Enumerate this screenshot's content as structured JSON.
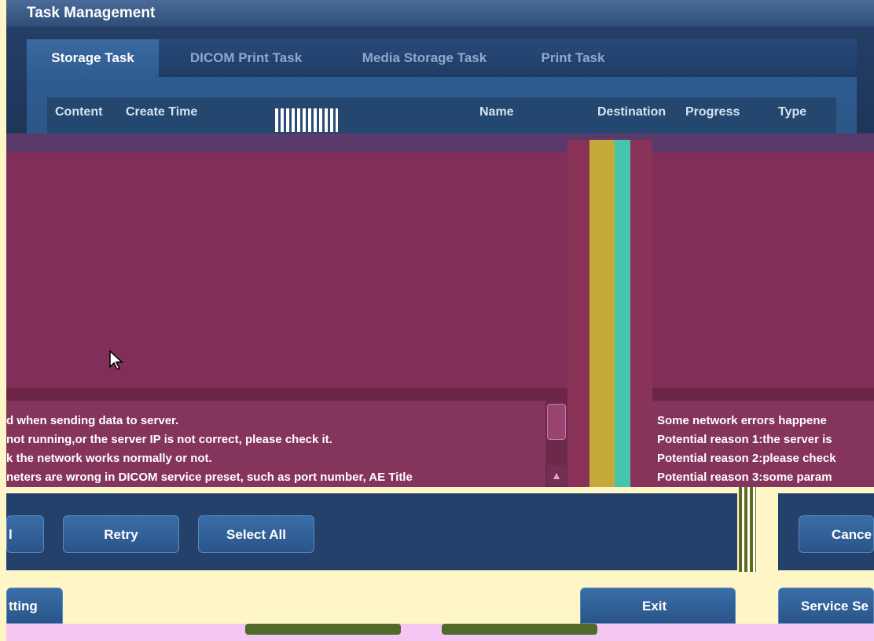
{
  "window": {
    "title": "Task Management"
  },
  "tabs": [
    {
      "label": "Storage Task",
      "active": true
    },
    {
      "label": "DICOM Print Task",
      "active": false
    },
    {
      "label": "Media Storage Task",
      "active": false
    },
    {
      "label": "Print Task",
      "active": false
    }
  ],
  "table": {
    "headers": [
      "Content",
      "Create Time",
      "Name",
      "Destination",
      "Progress",
      "Type"
    ]
  },
  "messages": {
    "left": [
      "d when sending data to server.",
      " not running,or the server IP is not correct, please check it.",
      "k the network works normally or not.",
      "neters are wrong in DICOM service preset, such as port number, AE Title"
    ],
    "right": [
      "Some network errors happene",
      "Potential reason 1:the server is",
      "Potential reason 2:please check",
      "Potential reason 3:some param"
    ]
  },
  "buttons": {
    "partial_left": "l",
    "retry": "Retry",
    "select_all": "Select All",
    "cancel": "Cance"
  },
  "footer": {
    "setting": "tting",
    "exit": "Exit",
    "service_setting": "Service Se"
  },
  "colors": {
    "magenta": "#812f58",
    "panel_blue": "#23416a",
    "accent_yellow": "#c5aa3b",
    "accent_teal": "#45c6ac"
  }
}
